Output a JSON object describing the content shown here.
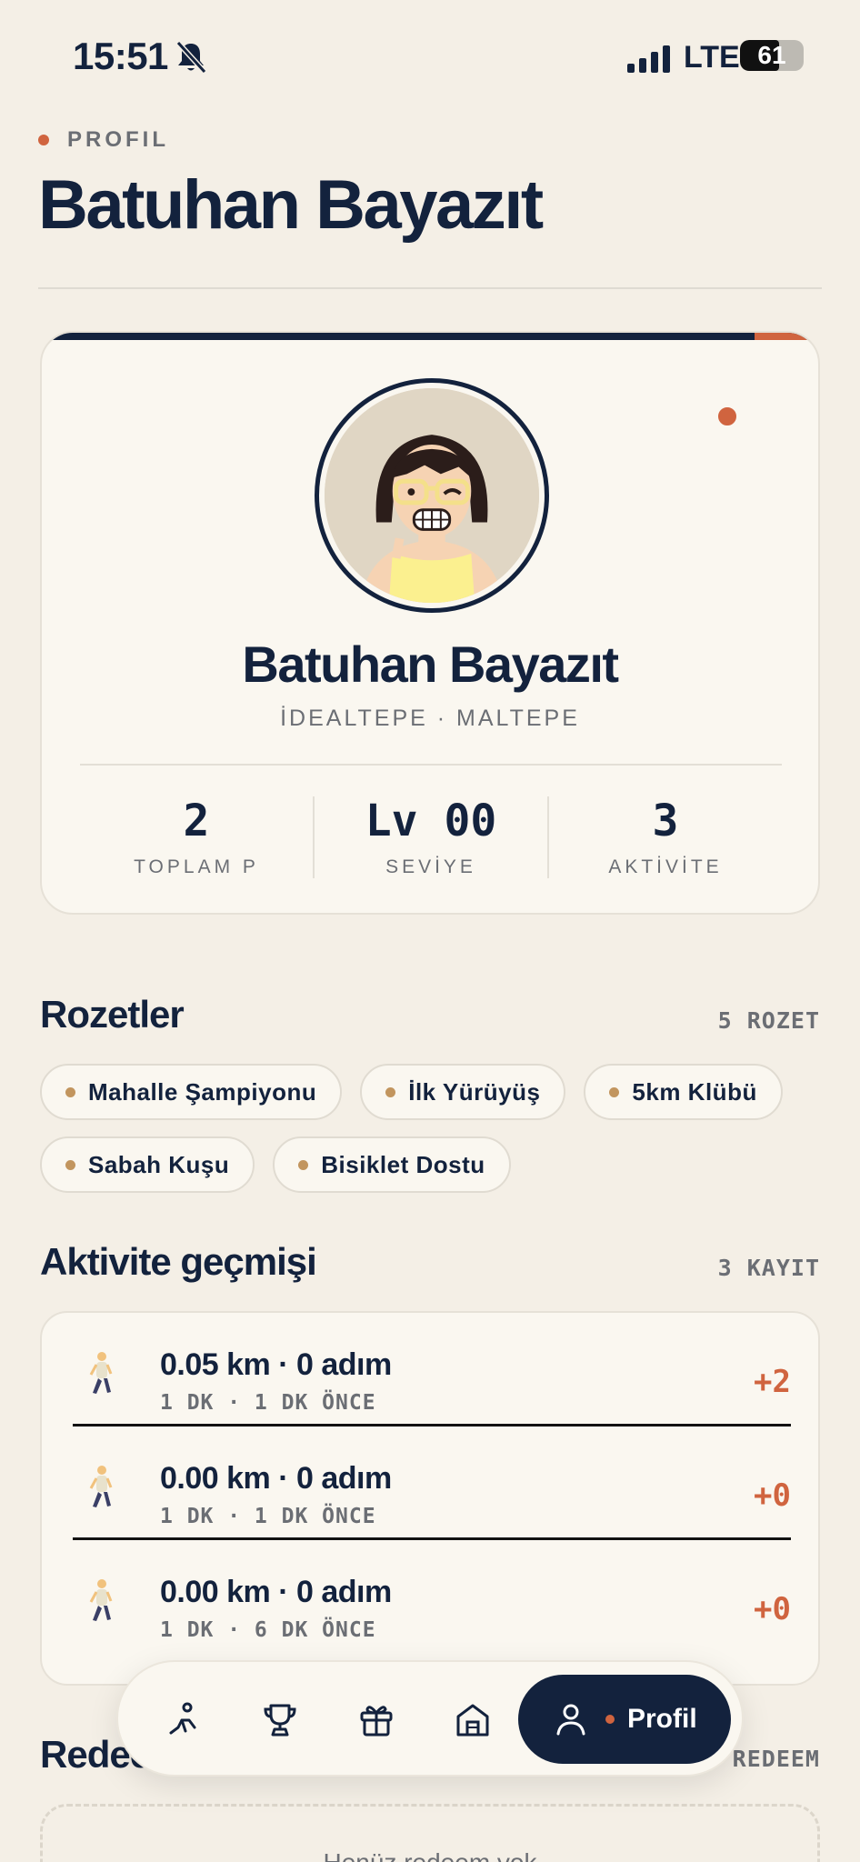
{
  "status_bar": {
    "time": "15:51",
    "network": "LTE",
    "battery": "61",
    "battery_level": 0.61
  },
  "header": {
    "eyebrow": "PROFIL",
    "title": "Batuhan Bayazıt"
  },
  "profile": {
    "name": "Batuhan Bayazıt",
    "location": "İDEALTEPE · MALTEPE",
    "stats": [
      {
        "value": "2",
        "label": "TOPLAM P"
      },
      {
        "value": "Lv 00",
        "label": "SEVİYE"
      },
      {
        "value": "3",
        "label": "AKTİVİTE"
      }
    ]
  },
  "badges": {
    "title": "Rozetler",
    "count": "5 ROZET",
    "items": [
      "Mahalle Şampiyonu",
      "İlk Yürüyüş",
      "5km Klübü",
      "Sabah Kuşu",
      "Bisiklet Dostu"
    ]
  },
  "activity": {
    "title": "Aktivite geçmişi",
    "count": "3 KAYIT",
    "items": [
      {
        "icon": "walking-person-icon",
        "title": "0.05 km · 0 adım",
        "meta": "1 DK · 1 DK ÖNCE",
        "points": "+2"
      },
      {
        "icon": "walking-person-icon",
        "title": "0.00 km · 0 adım",
        "meta": "1 DK · 1 DK ÖNCE",
        "points": "+0"
      },
      {
        "icon": "walking-person-icon",
        "title": "0.00 km · 0 adım",
        "meta": "1 DK · 6 DK ÖNCE",
        "points": "+0"
      }
    ]
  },
  "redeem": {
    "title": "Redeem geçmişi",
    "count": "0 REDEEM",
    "empty": "Henüz redeem yok"
  },
  "tabbar": {
    "tabs": [
      {
        "icon": "run-icon"
      },
      {
        "icon": "trophy-icon"
      },
      {
        "icon": "gift-icon"
      },
      {
        "icon": "home-icon"
      }
    ],
    "active": {
      "icon": "person-icon",
      "label": "Profil"
    }
  },
  "colors": {
    "navy": "#13223d",
    "accent": "#d0643f",
    "background": "#f4efe6",
    "card": "#faf7f0"
  }
}
